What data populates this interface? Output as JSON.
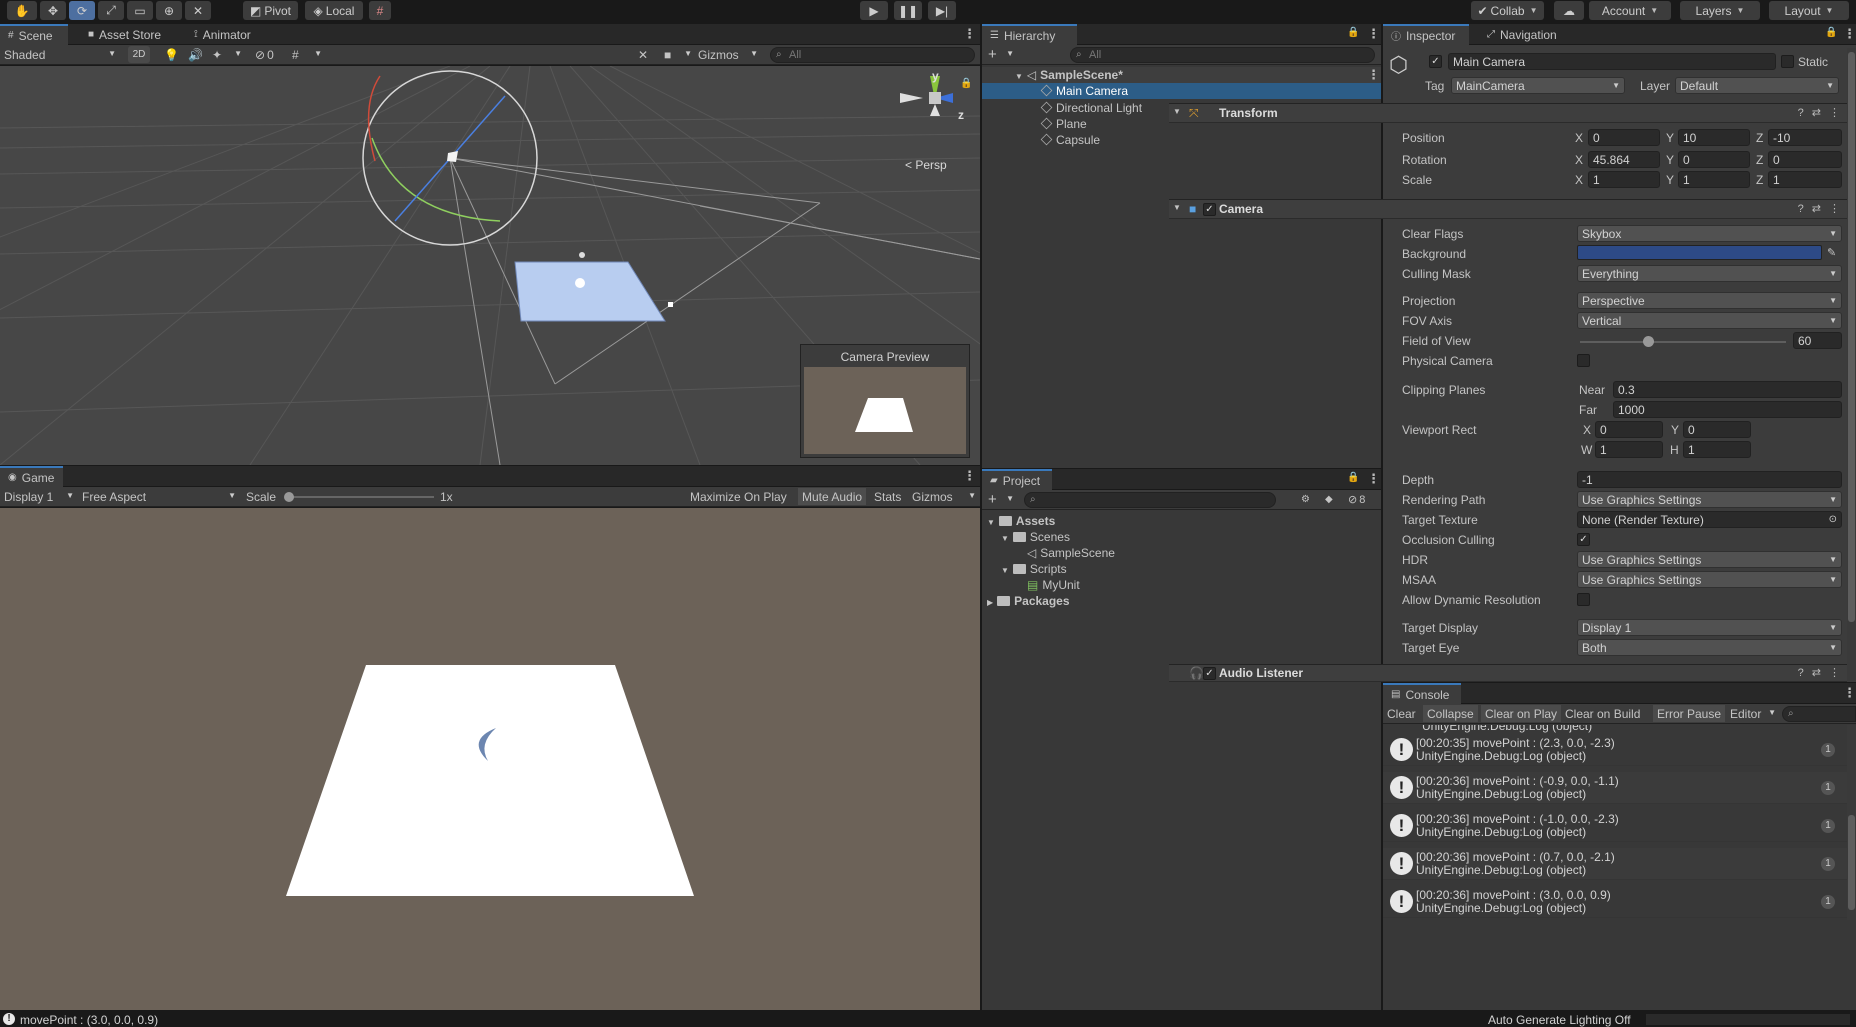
{
  "toolbar": {
    "pivot": "Pivot",
    "local": "Local",
    "collab": "Collab",
    "account": "Account",
    "layers": "Layers",
    "layout": "Layout"
  },
  "scene": {
    "tabs": [
      "Scene",
      "Asset Store",
      "Animator"
    ],
    "shading": "Shaded",
    "mode_2d": "2D",
    "hidden_count": "0",
    "gizmos": "Gizmos",
    "search_placeholder": "All",
    "persp": "Persp",
    "axis_y": "y",
    "axis_z": "z",
    "camera_preview_title": "Camera Preview"
  },
  "game": {
    "tab": "Game",
    "display": "Display 1",
    "aspect": "Free Aspect",
    "scale_label": "Scale",
    "scale_value": "1x",
    "maximize": "Maximize On Play",
    "mute": "Mute Audio",
    "stats": "Stats",
    "gizmos": "Gizmos"
  },
  "hierarchy": {
    "tab": "Hierarchy",
    "search_placeholder": "All",
    "scene_name": "SampleScene*",
    "items": [
      "Main Camera",
      "Directional Light",
      "Plane",
      "Capsule"
    ]
  },
  "project": {
    "tab": "Project",
    "hidden_count": "8",
    "assets": "Assets",
    "scenes": "Scenes",
    "sample_scene": "SampleScene",
    "scripts": "Scripts",
    "my_unit": "MyUnit",
    "packages": "Packages"
  },
  "inspector": {
    "tabs": [
      "Inspector",
      "Navigation"
    ],
    "object_name": "Main Camera",
    "static_label": "Static",
    "tag_label": "Tag",
    "tag_value": "MainCamera",
    "layer_label": "Layer",
    "layer_value": "Default",
    "transform": {
      "title": "Transform",
      "position_label": "Position",
      "rotation_label": "Rotation",
      "scale_label": "Scale",
      "position": {
        "x": "0",
        "y": "10",
        "z": "-10"
      },
      "rotation": {
        "x": "45.864",
        "y": "0",
        "z": "0"
      },
      "scale": {
        "x": "1",
        "y": "1",
        "z": "1"
      }
    },
    "camera": {
      "title": "Camera",
      "background_color": "#2d4a86",
      "rows": {
        "clear_flags": {
          "label": "Clear Flags",
          "value": "Skybox"
        },
        "background": {
          "label": "Background"
        },
        "culling_mask": {
          "label": "Culling Mask",
          "value": "Everything"
        },
        "projection": {
          "label": "Projection",
          "value": "Perspective"
        },
        "fov_axis": {
          "label": "FOV Axis",
          "value": "Vertical"
        },
        "field_of_view": {
          "label": "Field of View",
          "value": "60"
        },
        "physical_camera": {
          "label": "Physical Camera"
        },
        "clipping_planes": {
          "label": "Clipping Planes",
          "near_label": "Near",
          "near": "0.3",
          "far_label": "Far",
          "far": "1000"
        },
        "viewport_rect": {
          "label": "Viewport Rect",
          "x": "0",
          "y": "0",
          "w": "1",
          "h": "1"
        },
        "depth": {
          "label": "Depth",
          "value": "-1"
        },
        "rendering_path": {
          "label": "Rendering Path",
          "value": "Use Graphics Settings"
        },
        "target_texture": {
          "label": "Target Texture",
          "value": "None (Render Texture)"
        },
        "occlusion_culling": {
          "label": "Occlusion Culling"
        },
        "hdr": {
          "label": "HDR",
          "value": "Use Graphics Settings"
        },
        "msaa": {
          "label": "MSAA",
          "value": "Use Graphics Settings"
        },
        "allow_dynamic_resolution": {
          "label": "Allow Dynamic Resolution"
        },
        "target_display": {
          "label": "Target Display",
          "value": "Display 1"
        },
        "target_eye": {
          "label": "Target Eye",
          "value": "Both"
        }
      }
    },
    "audio_listener": {
      "title": "Audio Listener"
    }
  },
  "console": {
    "tab": "Console",
    "buttons": [
      "Clear",
      "Collapse",
      "Clear on Play",
      "Clear on Build",
      "Error Pause",
      "Editor"
    ],
    "partial_line": "UnityEngine.Debug:Log (object)",
    "logs": [
      {
        "line1": "[00:20:35] movePoint : (2.3, 0.0, -2.3)",
        "line2": "UnityEngine.Debug:Log (object)",
        "count": "1"
      },
      {
        "line1": "[00:20:36] movePoint : (-0.9, 0.0, -1.1)",
        "line2": "UnityEngine.Debug:Log (object)",
        "count": "1"
      },
      {
        "line1": "[00:20:36] movePoint : (-1.0, 0.0, -2.3)",
        "line2": "UnityEngine.Debug:Log (object)",
        "count": "1"
      },
      {
        "line1": "[00:20:36] movePoint : (0.7, 0.0, -2.1)",
        "line2": "UnityEngine.Debug:Log (object)",
        "count": "1"
      },
      {
        "line1": "[00:20:36] movePoint : (3.0, 0.0, 0.9)",
        "line2": "UnityEngine.Debug:Log (object)",
        "count": "1"
      }
    ]
  },
  "status": {
    "message": "movePoint : (3.0, 0.0, 0.9)",
    "lighting": "Auto Generate Lighting Off"
  }
}
